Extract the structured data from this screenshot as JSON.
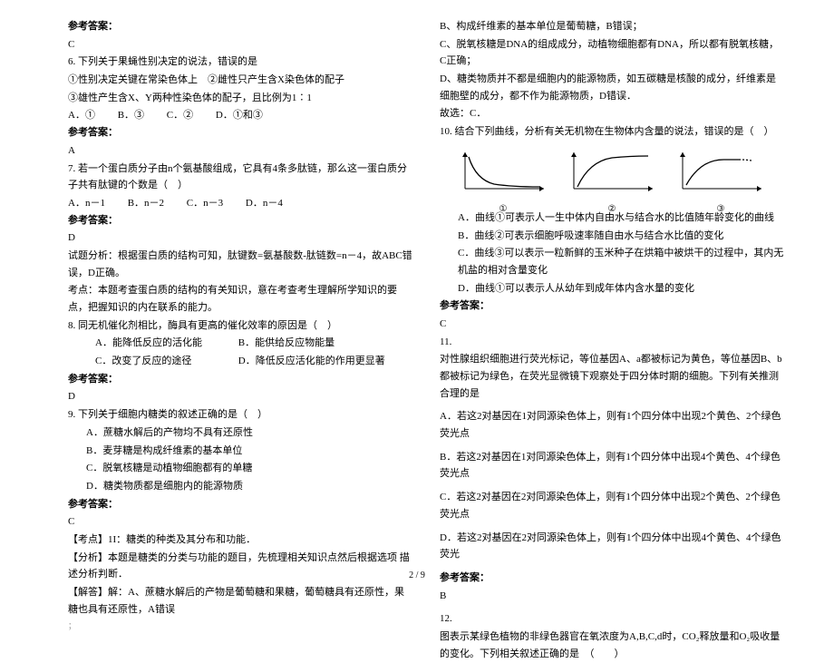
{
  "left": {
    "ans5_head": "参考答案：",
    "ans5": "C",
    "q6_stem": "6. 下列关于果蝇性别决定的说法，错误的是",
    "q6_s1": "①性别决定关键在常染色体上　②雌性只产生含X染色体的配子",
    "q6_s2": "③雄性产生含X、Y两种性染色体的配子，且比例为1∶1",
    "q6_a": "A．①",
    "q6_b": "B．③",
    "q6_c": "C．②",
    "q6_d": "D．①和③",
    "ans6_head": "参考答案：",
    "ans6": "A",
    "q7_stem": "7. 若一个蛋白质分子由n个氨基酸组成，它具有4条多肽链，那么这一蛋白质分子共有肽键的个数是（　）",
    "q7_a": "A．n－1",
    "q7_b": "B．n－2",
    "q7_c": "C．n－3",
    "q7_d": "D．n－4",
    "ans7_head": "参考答案：",
    "ans7": "D",
    "q7_fx": "试题分析：根据蛋白质的结构可知，肽键数=氨基酸数-肽链数=n－4，故ABC错误，D正确。",
    "q7_kd": "考点：本题考查蛋白质的结构的有关知识，意在考查考生理解所学知识的要点，把握知识的内在联系的能力。",
    "q8_stem": "8. 同无机催化剂相比，酶具有更高的催化效率的原因是（　）",
    "q8_a": "A．能降低反应的活化能",
    "q8_b": "B．能供给反应物能量",
    "q8_c": "C．改变了反应的途径",
    "q8_d": "D．降低反应活化能的作用更显著",
    "ans8_head": "参考答案：",
    "ans8": "D",
    "q9_stem": "9. 下列关于细胞内糖类的叙述正确的是（　）",
    "q9_a": "A．蔗糖水解后的产物均不具有还原性",
    "q9_b": "B．麦芽糖是构成纤维素的基本单位",
    "q9_c": "C．脱氧核糖是动植物细胞都有的单糖",
    "q9_d": "D．糖类物质都是细胞内的能源物质",
    "ans9_head": "参考答案：",
    "ans9": "C",
    "q9_kd": "【考点】1I：糖类的种类及其分布和功能．",
    "q9_fx2": "【分析】本题是糖类的分类与功能的题目，先梳理相关知识点然后根据选项 描述分析判断．",
    "q9_jd": "【解答】解：A、蔗糖水解后的产物是葡萄糖和果糖，葡萄糖具有还原性，果糖也具有还原性，A错误",
    "q9_cut": "；"
  },
  "right": {
    "r_b": "B、构成纤维素的基本单位是葡萄糖，B错误；",
    "r_c": "C、脱氧核糖是DNA的组成成分，动植物细胞都有DNA，所以都有脱氧核糖，C正确；",
    "r_d": "D、糖类物质并不都是细胞内的能源物质，如五碳糖是核酸的成分，纤维素是细胞壁的成分，都不作为能源物质，D错误．",
    "r_gx": "故选：C．",
    "q10_stem": "10. 结合下列曲线，分析有关无机物在生物体内含量的说法，错误的是（　）",
    "q10_a": "A．曲线①可表示人一生中体内自由水与结合水的比值随年龄变化的曲线",
    "q10_b": "B．曲线②可表示细胞呼吸速率随自由水与结合水比值的变化",
    "q10_c": "C．曲线③可以表示一粒新鲜的玉米种子在烘箱中被烘干的过程中，其内无机盐的相对含量变化",
    "q10_d": "D．曲线①可以表示人从幼年到成年体内含水量的变化",
    "ans10_head": "参考答案：",
    "ans10": "C",
    "q11_head": "11.",
    "q11_stem": "对性腺组织细胞进行荧光标记，等位基因A、a都被标记为黄色，等位基因B、b都被标记为绿色，在荧光显微镜下观察处于四分体时期的细胞。下列有关推测合理的是",
    "q11_a": "A．若这2对基因在1对同源染色体上，则有1个四分体中出现2个黄色、2个绿色荧光点",
    "q11_b": "B．若这2对基因在1对同源染色体上，则有1个四分体中出现4个黄色、4个绿色荧光点",
    "q11_c": "C．若这2对基因在2对同源染色体上，则有1个四分体中出现2个黄色、2个绿色荧光点",
    "q11_d": "D．若这2对基因在2对同源染色体上，则有1个四分体中出现4个黄色、4个绿色荧光",
    "ans11_head": "参考答案：",
    "ans11": "B",
    "q12_head": "12.",
    "q12_stem": "图表示某绿色植物的非绿色器官在氧浓度为A,B,C,d时，CO₂释放量和O₂吸收量的变化。下列相关叙述正确的是　（　　）",
    "chart_labels": {
      "c1": "①",
      "c2": "②",
      "c3": "③"
    }
  },
  "pager": "2 / 9"
}
